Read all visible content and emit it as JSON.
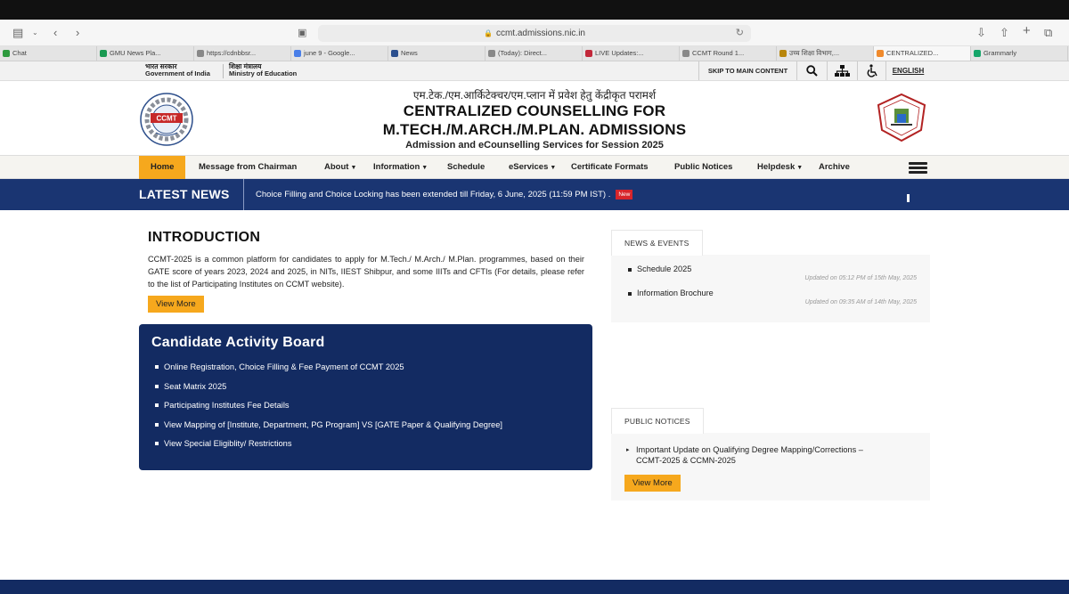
{
  "browser": {
    "url": "ccmt.admissions.nic.in",
    "tabs": [
      {
        "label": "Chat",
        "color": "#2e9a3e"
      },
      {
        "label": "GMU News Pla...",
        "color": "#1a9a52"
      },
      {
        "label": "https://cdnbbsr...",
        "color": "#888888"
      },
      {
        "label": "june 9 - Google...",
        "color": "#4a7fe8"
      },
      {
        "label": "News",
        "color": "#2b4f8e"
      },
      {
        "label": "(Today): Direct...",
        "color": "#888888"
      },
      {
        "label": "LIVE Updates:...",
        "color": "#c2283a"
      },
      {
        "label": "CCMT Round 1...",
        "color": "#888888"
      },
      {
        "label": "उच्च शिक्षा विभाग,...",
        "color": "#b8860b"
      },
      {
        "label": "CENTRALIZED...",
        "color": "#f08a2c"
      },
      {
        "label": "Grammarly",
        "color": "#15a569"
      }
    ]
  },
  "govbar": {
    "gov_hi": "भारत सरकार",
    "gov_en": "Government of India",
    "min_hi": "शिक्षा मंत्रालय",
    "min_en": "Ministry of Education",
    "skip": "SKIP TO MAIN CONTENT",
    "lang": "ENGLISH"
  },
  "header": {
    "hindi": "एम.टेक./एम.आर्किटेक्चर/एम.प्लान में प्रवेश हेतु केंद्रीकृत परामर्श",
    "title1": "CENTRALIZED COUNSELLING FOR",
    "title2": "M.TECH./M.ARCH./M.PLAN. ADMISSIONS",
    "subtitle": "Admission and eCounselling Services for Session 2025",
    "logo_text": "CCMT",
    "logo_ring": "Empowering Engineers of Future"
  },
  "nav": {
    "items": [
      "Home",
      "Message from Chairman",
      "About",
      "Information",
      "Schedule",
      "eServices",
      "Certificate Formats",
      "Public Notices",
      "Helpdesk",
      "Archive"
    ]
  },
  "news": {
    "label": "LATEST NEWS",
    "text": "Choice Filling and Choice Locking has been extended till Friday, 6 June, 2025 (11:59 PM IST) .",
    "badge": "New"
  },
  "intro": {
    "title": "INTRODUCTION",
    "text": "CCMT-2025 is a common platform for candidates to apply for M.Tech./ M.Arch./ M.Plan. programmes, based on their GATE score of years 2023, 2024 and 2025, in NITs, IIEST Shibpur, and some IIITs and CFTIs (For details, please refer to the list of Participating Institutes on CCMT website).",
    "button": "View More"
  },
  "activity": {
    "title": "Candidate Activity Board",
    "items": [
      "Online Registration, Choice Filling & Fee Payment of CCMT 2025",
      "Seat Matrix 2025",
      "Participating Institutes Fee Details",
      "View Mapping of [Institute, Department, PG Program] VS [GATE Paper & Qualifying Degree]",
      "View Special Eligiblity/ Restrictions"
    ]
  },
  "news_events": {
    "tab": "NEWS & EVENTS",
    "items": [
      {
        "label": "Schedule 2025",
        "date": "Updated on 05:12 PM of 15th May, 2025"
      },
      {
        "label": "Information Brochure",
        "date": "Updated on 09:35 AM of 14th May, 2025"
      }
    ]
  },
  "public_notices": {
    "tab": "PUBLIC NOTICES",
    "item_line1": "Important Update on Qualifying Degree Mapping/Corrections –",
    "item_line2": "CCMT-2025 & CCMN-2025",
    "button": "View More"
  }
}
